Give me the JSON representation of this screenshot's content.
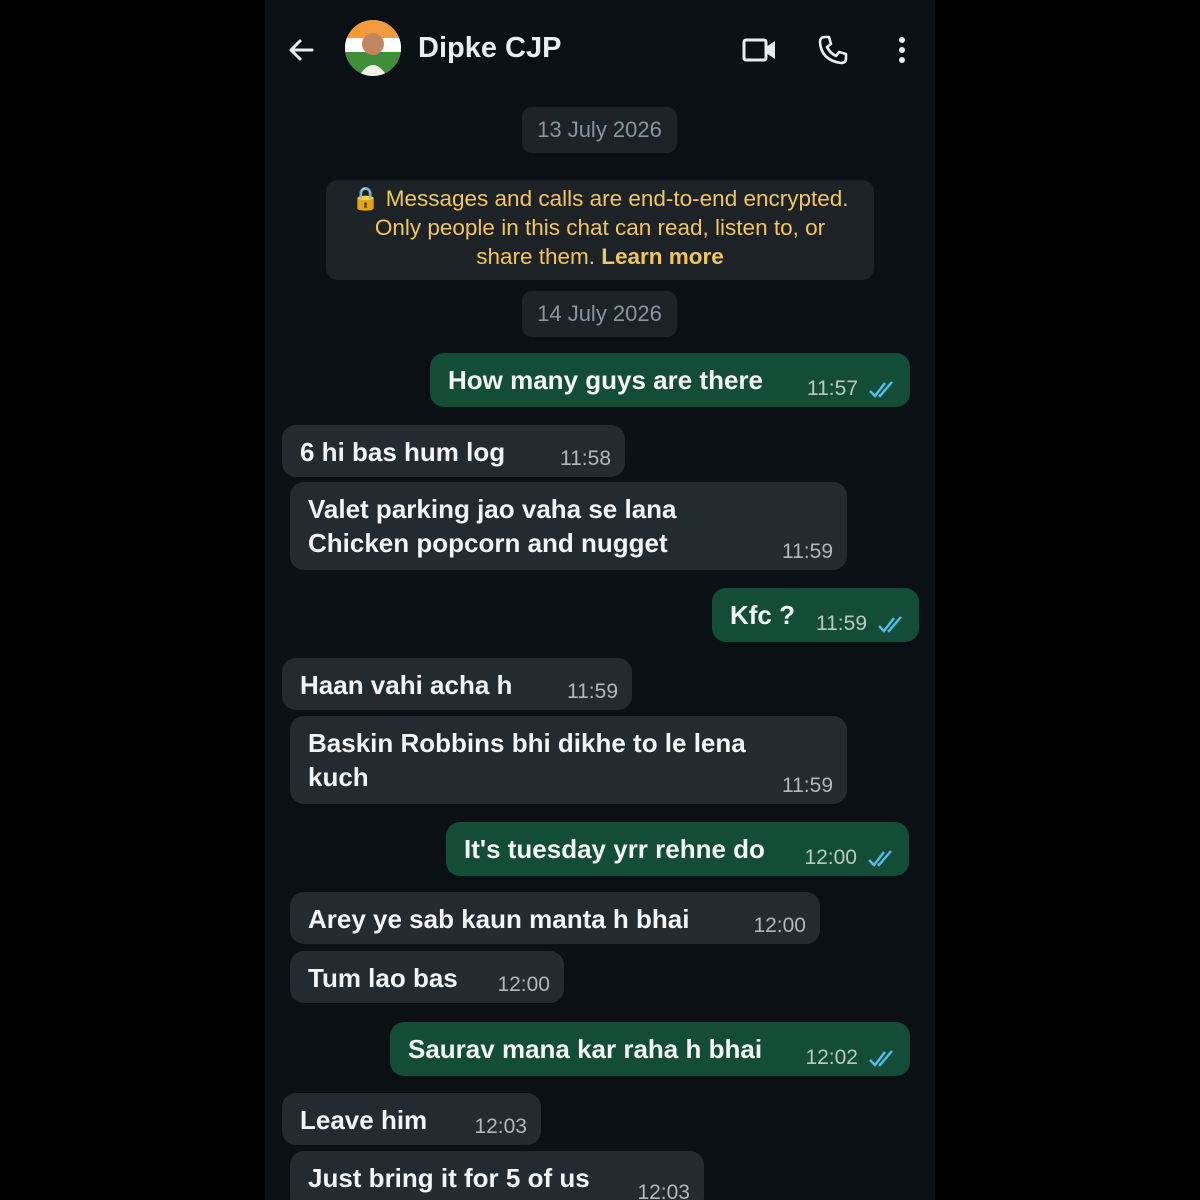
{
  "header": {
    "back_icon": "arrow-left-icon",
    "contact_name": "Dipke CJP",
    "video_icon": "video-call-icon",
    "call_icon": "phone-icon",
    "menu_icon": "more-vert-icon"
  },
  "chat": {
    "date1": "13 July 2026",
    "encryption_text": "Messages and calls are end-to-end encrypted.",
    "encryption_line2": "Only people in this chat can read, listen to, or",
    "encryption_line3": "share them.",
    "encryption_link": "Learn more",
    "date2": "14 July 2026",
    "messages": [
      {
        "dir": "out",
        "text": "How many guys are there",
        "time": "11:57"
      },
      {
        "dir": "in",
        "text": "6 hi bas hum log",
        "time": "11:58"
      },
      {
        "dir": "in",
        "text": "Valet parking jao vaha se lana\nChicken popcorn and nugget",
        "time": "11:59"
      },
      {
        "dir": "out",
        "text": "Kfc ?",
        "time": "11:59"
      },
      {
        "dir": "in",
        "text": "Haan vahi acha h",
        "time": "11:59"
      },
      {
        "dir": "in",
        "text": "Baskin Robbins bhi dikhe to le lena\nkuch",
        "time": "11:59"
      },
      {
        "dir": "out",
        "text": "It's tuesday yrr rehne do",
        "time": "12:00"
      },
      {
        "dir": "in",
        "text": "Arey ye sab kaun manta h bhai",
        "time": "12:00"
      },
      {
        "dir": "in",
        "text": "Tum lao bas",
        "time": "12:00"
      },
      {
        "dir": "out",
        "text": "Saurav mana kar raha h bhai",
        "time": "12:02"
      },
      {
        "dir": "in",
        "text": "Leave him",
        "time": "12:03"
      },
      {
        "dir": "in",
        "text": "Just bring it for 5 of us",
        "time": "12:03"
      }
    ]
  },
  "colors": {
    "outgoing_bubble": "#144d37",
    "incoming_bubble": "#242b30",
    "read_tick": "#53bdeb",
    "encryption_text": "#f2c65f"
  }
}
